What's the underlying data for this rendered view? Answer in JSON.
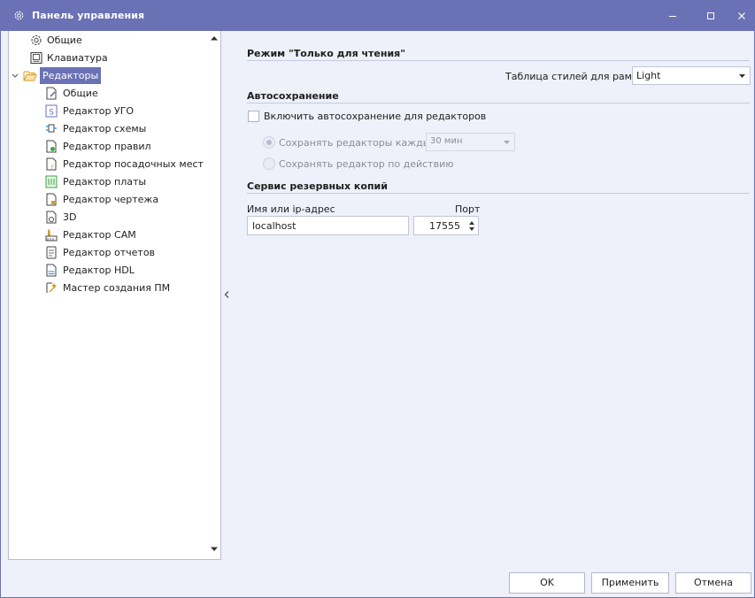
{
  "window": {
    "title": "Панель управления",
    "title_icon": "gear-icon",
    "colors": {
      "titlebar": "#6a71b4",
      "background": "#eef0fa",
      "selection": "#6a71b4"
    }
  },
  "sidebar": {
    "items": [
      {
        "label": "Общие",
        "icon": "gear-icon"
      },
      {
        "label": "Клавиатура",
        "icon": "keyboard-icon"
      },
      {
        "label": "Редакторы",
        "icon": "folder-open-icon",
        "expanded": true,
        "selected": true
      },
      {
        "label": "Общие",
        "icon": "document-edit-icon"
      },
      {
        "label": "Редактор УГО",
        "icon": "symbol-editor-icon"
      },
      {
        "label": "Редактор схемы",
        "icon": "schematic-editor-icon"
      },
      {
        "label": "Редактор правил",
        "icon": "rules-editor-icon"
      },
      {
        "label": "Редактор посадочных мест",
        "icon": "footprint-editor-icon"
      },
      {
        "label": "Редактор платы",
        "icon": "pcb-editor-icon"
      },
      {
        "label": "Редактор чертежа",
        "icon": "drawing-editor-icon"
      },
      {
        "label": "3D",
        "icon": "3d-icon"
      },
      {
        "label": "Редактор CAM",
        "icon": "cam-editor-icon"
      },
      {
        "label": "Редактор отчетов",
        "icon": "report-editor-icon"
      },
      {
        "label": "Редактор HDL",
        "icon": "hdl-editor-icon"
      },
      {
        "label": "Мастер создания ПМ",
        "icon": "wizard-icon"
      }
    ]
  },
  "main": {
    "readonly": {
      "title": "Режим \"Только для чтения\"",
      "stylesheet_label": "Таблица стилей для рамки:",
      "stylesheet_value": "Light"
    },
    "autosave": {
      "title": "Автосохранение",
      "enable_label": "Включить автосохранение для редакторов",
      "enabled": false,
      "every_label": "Сохранять редакторы каждые",
      "every_value": "30 мин",
      "by_action_label": "Сохранять редактор по действию"
    },
    "backup": {
      "title": "Сервис резервных копий",
      "host_label": "Имя или ip-адрес",
      "host_value": "localhost",
      "port_label": "Порт",
      "port_value": "17555"
    }
  },
  "footer": {
    "ok_label": "OK",
    "apply_label": "Применить",
    "cancel_label": "Отмена"
  }
}
